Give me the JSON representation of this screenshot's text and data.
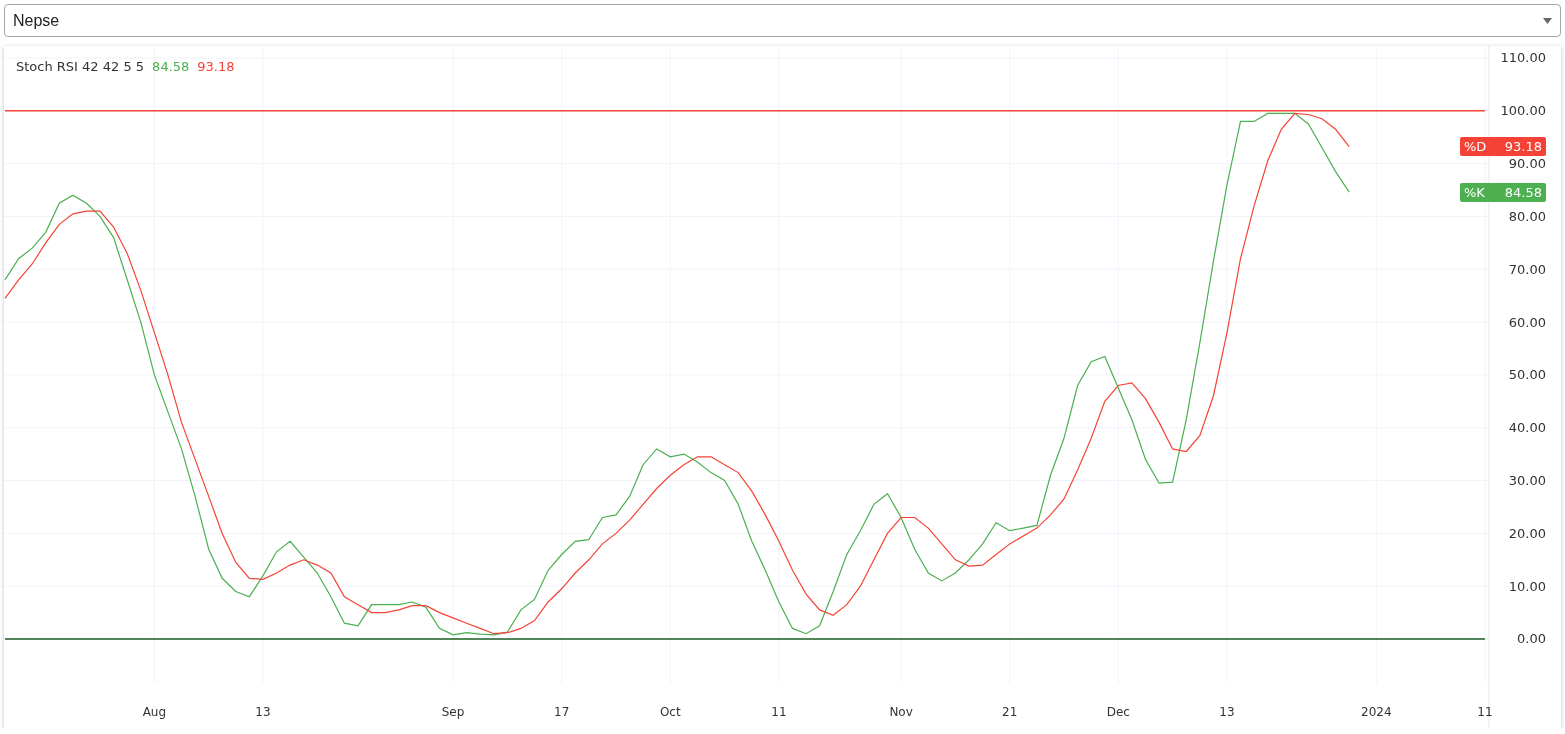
{
  "symbol_select": {
    "value": "Nepse"
  },
  "chart": {
    "legend": {
      "title": "Stoch RSI 42 42 5 5",
      "values": [
        {
          "text": "84.58",
          "color": "#4caf50"
        },
        {
          "text": "93.18",
          "color": "#f44336"
        }
      ]
    },
    "badges": [
      {
        "text": "93.18"
      },
      {
        "text": "84.58"
      }
    ],
    "chart_data": {
      "type": "line",
      "categories": [
        null,
        null,
        null,
        null,
        null,
        null,
        null,
        null,
        null,
        null,
        null,
        "Aug",
        null,
        null,
        null,
        null,
        null,
        null,
        null,
        "13",
        null,
        null,
        null,
        null,
        null,
        null,
        null,
        null,
        null,
        null,
        null,
        null,
        null,
        "Sep",
        null,
        null,
        null,
        null,
        null,
        null,
        null,
        "17",
        null,
        null,
        null,
        null,
        null,
        null,
        null,
        "Oct",
        null,
        null,
        null,
        null,
        null,
        null,
        null,
        "11",
        null,
        null,
        null,
        null,
        null,
        null,
        null,
        null,
        "Nov",
        null,
        null,
        null,
        null,
        null,
        null,
        null,
        "21",
        null,
        null,
        null,
        null,
        null,
        null,
        null,
        "Dec",
        null,
        null,
        null,
        null,
        null,
        null,
        null,
        "13",
        null,
        null,
        null,
        null,
        null,
        null,
        null,
        null,
        null,
        null,
        "2024",
        null,
        null,
        null,
        null,
        null,
        null,
        null,
        "11"
      ],
      "series": [
        {
          "color": "#f44336",
          "values": [
            100,
            100,
            100,
            100,
            100,
            100,
            100,
            100,
            100,
            100,
            100,
            100,
            100,
            100,
            100,
            100,
            100,
            100,
            100,
            100,
            100,
            100,
            100,
            100,
            100,
            100,
            100,
            100,
            100,
            100,
            100,
            100,
            100,
            100,
            100,
            100,
            100,
            100,
            100,
            100,
            100,
            100,
            100,
            100,
            100,
            100,
            100,
            100,
            100,
            100,
            100,
            100,
            100,
            100,
            100,
            100,
            100,
            100,
            100,
            100,
            100,
            100,
            100,
            100,
            100,
            100,
            100,
            100,
            100,
            100,
            100,
            100,
            100,
            100,
            100,
            100,
            100,
            100,
            100,
            100,
            100,
            100,
            100,
            100,
            100,
            100,
            100,
            100,
            100,
            100,
            100,
            100,
            100,
            100,
            100,
            100,
            100,
            100,
            100,
            100,
            100,
            100,
            100,
            100,
            100,
            100,
            100,
            100,
            100,
            100
          ]
        },
        {
          "color": "#1b5e20",
          "values": [
            0,
            0,
            0,
            0,
            0,
            0,
            0,
            0,
            0,
            0,
            0,
            0,
            0,
            0,
            0,
            0,
            0,
            0,
            0,
            0,
            0,
            0,
            0,
            0,
            0,
            0,
            0,
            0,
            0,
            0,
            0,
            0,
            0,
            0,
            0,
            0,
            0,
            0,
            0,
            0,
            0,
            0,
            0,
            0,
            0,
            0,
            0,
            0,
            0,
            0,
            0,
            0,
            0,
            0,
            0,
            0,
            0,
            0,
            0,
            0,
            0,
            0,
            0,
            0,
            0,
            0,
            0,
            0,
            0,
            0,
            0,
            0,
            0,
            0,
            0,
            0,
            0,
            0,
            0,
            0,
            0,
            0,
            0,
            0,
            0,
            0,
            0,
            0,
            0,
            0,
            0,
            0,
            0,
            0,
            0,
            0,
            0,
            0,
            0,
            0,
            0,
            0,
            0,
            0,
            0,
            0,
            0,
            0,
            0,
            0
          ]
        },
        {
          "name": "%K",
          "color": "#4caf50",
          "values": [
            68,
            72,
            74,
            77,
            82.5,
            84,
            82.5,
            80,
            76,
            68,
            60,
            50,
            43,
            36,
            27,
            17,
            11.5,
            9,
            8,
            12,
            16.5,
            18.5,
            15.5,
            12.5,
            8,
            3,
            2.5,
            6.5,
            6.5,
            6.5,
            7,
            6,
            2,
            0.8,
            1.2,
            0.9,
            0.8,
            1.3,
            5.5,
            7.5,
            13,
            16,
            18.5,
            18.8,
            23,
            23.5,
            27,
            33,
            36,
            34.5,
            35,
            33.5,
            31.5,
            30,
            25.5,
            18.5,
            13,
            7,
            2,
            1,
            2.5,
            9,
            16,
            20.5,
            25.5,
            27.5,
            23,
            17,
            12.5,
            11,
            12.5,
            15,
            18,
            22,
            20.5,
            21,
            21.5,
            31,
            38,
            48,
            52.5,
            53.5,
            47.5,
            41.5,
            34,
            29.5,
            29.7,
            41.5,
            56,
            71.5,
            86,
            98,
            98,
            99.5,
            99.5,
            99.5,
            97.5,
            93,
            88.5,
            84.6,
            null,
            null,
            null,
            null,
            null,
            null,
            null,
            null,
            null,
            null
          ]
        },
        {
          "name": "%D",
          "color": "#f44336",
          "values": [
            64.5,
            68,
            71,
            75,
            78.5,
            80.5,
            81,
            81,
            78,
            73,
            66,
            58,
            50,
            41,
            34,
            27,
            20,
            14.5,
            11.5,
            11.3,
            12.5,
            14,
            15,
            14,
            12.5,
            8,
            6.5,
            5,
            5,
            5.5,
            6.3,
            6.3,
            5,
            4,
            3,
            2,
            1,
            1.2,
            2,
            3.5,
            7,
            9.5,
            12.5,
            15,
            18,
            20,
            22.5,
            25.5,
            28.5,
            31,
            33,
            34.5,
            34.5,
            33,
            31.5,
            28,
            23.5,
            18.5,
            13,
            8.5,
            5.5,
            4.5,
            6.5,
            10,
            15,
            20,
            23,
            23,
            21,
            18,
            15,
            13.8,
            14,
            16,
            18,
            19.5,
            21,
            23.5,
            26.5,
            32,
            38,
            45,
            48,
            48.5,
            45.5,
            41,
            36,
            35.5,
            38.5,
            46,
            58,
            72,
            82,
            90.5,
            96.5,
            99.5,
            99.3,
            98.5,
            96.5,
            93.2,
            null,
            null,
            null,
            null,
            null,
            null,
            null,
            null,
            null,
            null
          ]
        }
      ],
      "ylim": [
        -16.85,
        112.27
      ],
      "grid": true,
      "yticks": [
        {
          "value": 0,
          "label": "0.00"
        },
        {
          "value": 10,
          "label": "10.00"
        },
        {
          "value": 20,
          "label": "20.00"
        },
        {
          "value": 30,
          "label": "30.00"
        },
        {
          "value": 40,
          "label": "40.00"
        },
        {
          "value": 50,
          "label": "50.00"
        },
        {
          "value": 60,
          "label": "60.00"
        },
        {
          "value": 70,
          "label": "70.00"
        },
        {
          "value": 80,
          "label": "80.00"
        },
        {
          "value": 90,
          "label": "90.00"
        },
        {
          "value": 100,
          "label": "100.00"
        },
        {
          "value": 110,
          "label": "110.00"
        }
      ]
    }
  }
}
